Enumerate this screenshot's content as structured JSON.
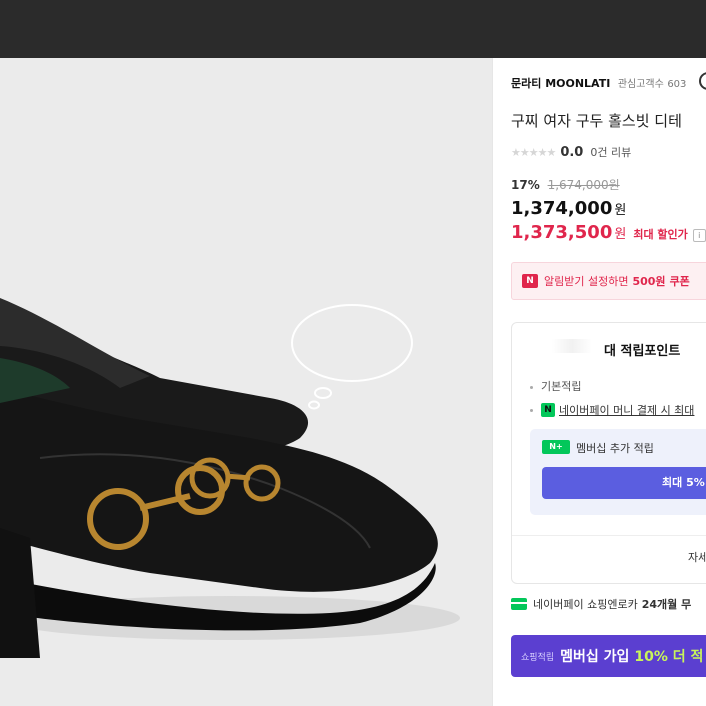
{
  "store": {
    "name": "문라티 MOONLATI",
    "follow_label": "관심고객수",
    "follow_count": "603"
  },
  "product": {
    "title": "구찌 여자 구두 홀스빗 디테",
    "stars": "★★★★★",
    "rating": "0.0",
    "review_count": "0건 리뷰",
    "discount_pct": "17%",
    "original_price": "1,674,000원",
    "price": "1,374,000",
    "price_unit": "원",
    "max_discount_price": "1,373,500",
    "max_discount_unit": "원",
    "max_discount_label": "최대 할인가",
    "info_icon": "i"
  },
  "coupon": {
    "badge": "N",
    "text": "알림받기 설정하면",
    "amount": "500원",
    "suffix": "쿠폰"
  },
  "points": {
    "title": "대 적립포인트",
    "basic_label": "기본적립",
    "npay_icon": "N",
    "npay_text": "네이버페이 머니 결제 시 최대",
    "membership_badge": "N",
    "membership_plus": "+",
    "membership_label": "멤버십 추가 적립",
    "max_button": "최대 5%",
    "detail_link": "자세"
  },
  "shopping": {
    "text": "네이버페이 쇼핑엔로카",
    "bold": "24개월 무"
  },
  "member_banner": {
    "tag": "쇼핑적립",
    "main": "멤버십 가입",
    "highlight": "10% 더 적"
  },
  "colors": {
    "topbar": "#2b2b2b",
    "accent_red": "#e0264c",
    "naver_green": "#03c75a",
    "membership_purple": "#5b3fd0"
  }
}
